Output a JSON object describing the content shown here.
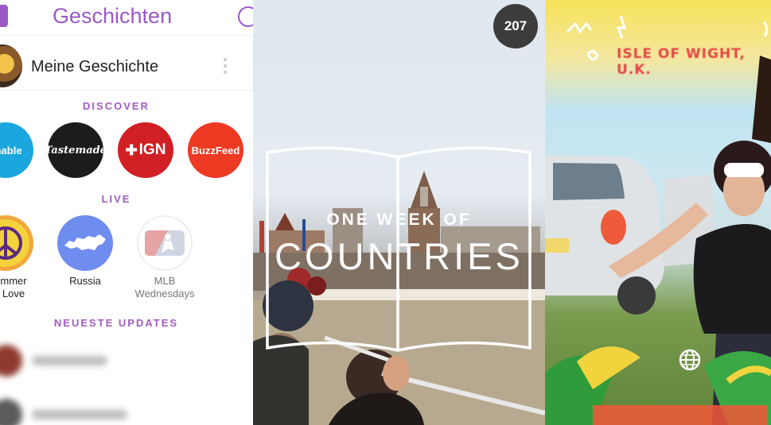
{
  "stories_panel": {
    "title": "Geschichten",
    "my_story_label": "Meine Geschichte",
    "sections": {
      "discover": "DISCOVER",
      "live": "LIVE",
      "recent": "NEUESTE UPDATES"
    },
    "discover_channels": [
      {
        "label": "shable",
        "color": "#1aa7dd"
      },
      {
        "label": "Tastemade",
        "color": "#1d1c1d"
      },
      {
        "label": "IGN",
        "color": "#d02024"
      },
      {
        "label": "BuzzFeed",
        "color": "#ee3a23"
      }
    ],
    "live_stories": [
      {
        "label_line1": "mmer",
        "label_line2": "Love",
        "icon": "peace-sign-icon"
      },
      {
        "label_line1": "Russia",
        "icon": "russia-map-icon"
      },
      {
        "label_line1": "MLB",
        "label_line2": "Wednesdays",
        "icon": "mlb-logo-icon"
      }
    ],
    "accent_color": "#9b59c8"
  },
  "our_story_panel": {
    "view_count": "207",
    "overlay_line1": "ONE WEEK OF",
    "overlay_line2": "COUNTRIES"
  },
  "live_snap_panel": {
    "geofilter_text": "ISLE OF WIGHT, U.K."
  }
}
